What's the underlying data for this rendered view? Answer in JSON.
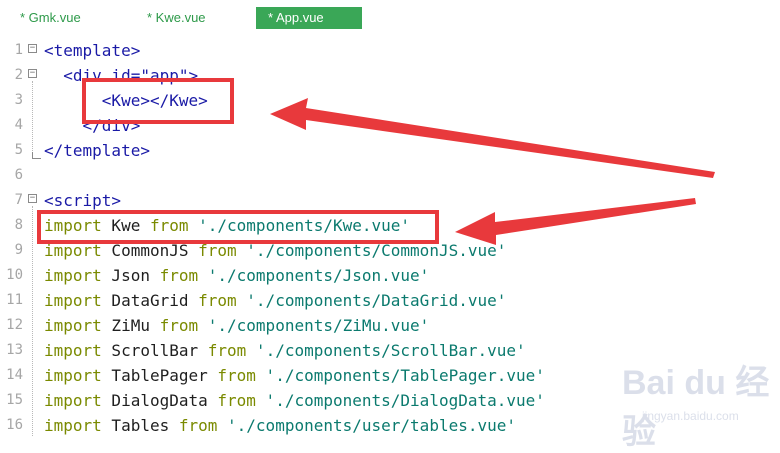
{
  "tabs": [
    {
      "label": "* Gmk.vue",
      "active": false
    },
    {
      "label": "* Kwe.vue",
      "active": false
    },
    {
      "label": "* App.vue",
      "active": true
    }
  ],
  "lines": [
    {
      "n": "1",
      "fold": "⊟",
      "parts": [
        {
          "t": "<template>",
          "c": "tag"
        }
      ]
    },
    {
      "n": "2",
      "fold": "⊟",
      "parts": [
        {
          "t": "  <div id=\"app\">",
          "c": "tag"
        }
      ]
    },
    {
      "n": "3",
      "fold": "",
      "parts": [
        {
          "t": "      <Kwe></Kwe>",
          "c": "tag"
        }
      ]
    },
    {
      "n": "4",
      "fold": "",
      "parts": [
        {
          "t": "    </div>",
          "c": "tag"
        }
      ]
    },
    {
      "n": "5",
      "fold": "",
      "parts": [
        {
          "t": "</template>",
          "c": "tag"
        }
      ]
    },
    {
      "n": "6",
      "fold": "",
      "parts": []
    },
    {
      "n": "7",
      "fold": "⊟",
      "parts": [
        {
          "t": "<script>",
          "c": "tag"
        }
      ]
    },
    {
      "n": "8",
      "fold": "",
      "parts": [
        {
          "t": "import",
          "c": "kw"
        },
        {
          "t": " Kwe ",
          "c": "ident"
        },
        {
          "t": "from",
          "c": "kw"
        },
        {
          "t": " './components/Kwe.vue'",
          "c": "str"
        }
      ]
    },
    {
      "n": "9",
      "fold": "",
      "parts": [
        {
          "t": "import",
          "c": "kw"
        },
        {
          "t": " CommonJS ",
          "c": "ident"
        },
        {
          "t": "from",
          "c": "kw"
        },
        {
          "t": " './components/CommonJS.vue'",
          "c": "str"
        }
      ]
    },
    {
      "n": "10",
      "fold": "",
      "parts": [
        {
          "t": "import",
          "c": "kw"
        },
        {
          "t": " Json ",
          "c": "ident"
        },
        {
          "t": "from",
          "c": "kw"
        },
        {
          "t": " './components/Json.vue'",
          "c": "str"
        }
      ]
    },
    {
      "n": "11",
      "fold": "",
      "parts": [
        {
          "t": "import",
          "c": "kw"
        },
        {
          "t": " DataGrid ",
          "c": "ident"
        },
        {
          "t": "from",
          "c": "kw"
        },
        {
          "t": " './components/DataGrid.vue'",
          "c": "str"
        }
      ]
    },
    {
      "n": "12",
      "fold": "",
      "parts": [
        {
          "t": "import",
          "c": "kw"
        },
        {
          "t": " ZiMu ",
          "c": "ident"
        },
        {
          "t": "from",
          "c": "kw"
        },
        {
          "t": " './components/ZiMu.vue'",
          "c": "str"
        }
      ]
    },
    {
      "n": "13",
      "fold": "",
      "parts": [
        {
          "t": "import",
          "c": "kw"
        },
        {
          "t": " ScrollBar ",
          "c": "ident"
        },
        {
          "t": "from",
          "c": "kw"
        },
        {
          "t": " './components/ScrollBar.vue'",
          "c": "str"
        }
      ]
    },
    {
      "n": "14",
      "fold": "",
      "parts": [
        {
          "t": "import",
          "c": "kw"
        },
        {
          "t": " TablePager ",
          "c": "ident"
        },
        {
          "t": "from",
          "c": "kw"
        },
        {
          "t": " './components/TablePager.vue'",
          "c": "str"
        }
      ]
    },
    {
      "n": "15",
      "fold": "",
      "parts": [
        {
          "t": "import",
          "c": "kw"
        },
        {
          "t": " DialogData ",
          "c": "ident"
        },
        {
          "t": "from",
          "c": "kw"
        },
        {
          "t": " './components/DialogData.vue'",
          "c": "str"
        }
      ]
    },
    {
      "n": "16",
      "fold": "",
      "parts": [
        {
          "t": "import",
          "c": "kw"
        },
        {
          "t": " Tables ",
          "c": "ident"
        },
        {
          "t": "from",
          "c": "kw"
        },
        {
          "t": " './components/user/tables.vue'",
          "c": "str"
        }
      ]
    }
  ],
  "watermark": {
    "logo": "Bai du 经验",
    "sub": "jingyan.baidu.com"
  },
  "colors": {
    "tab_active_bg": "#3aa757",
    "tab_text": "#2e9a4a",
    "tag": "#1a1aa6",
    "keyword": "#7a8a00",
    "string": "#0b7a6e",
    "annotation": "#e8393c"
  }
}
